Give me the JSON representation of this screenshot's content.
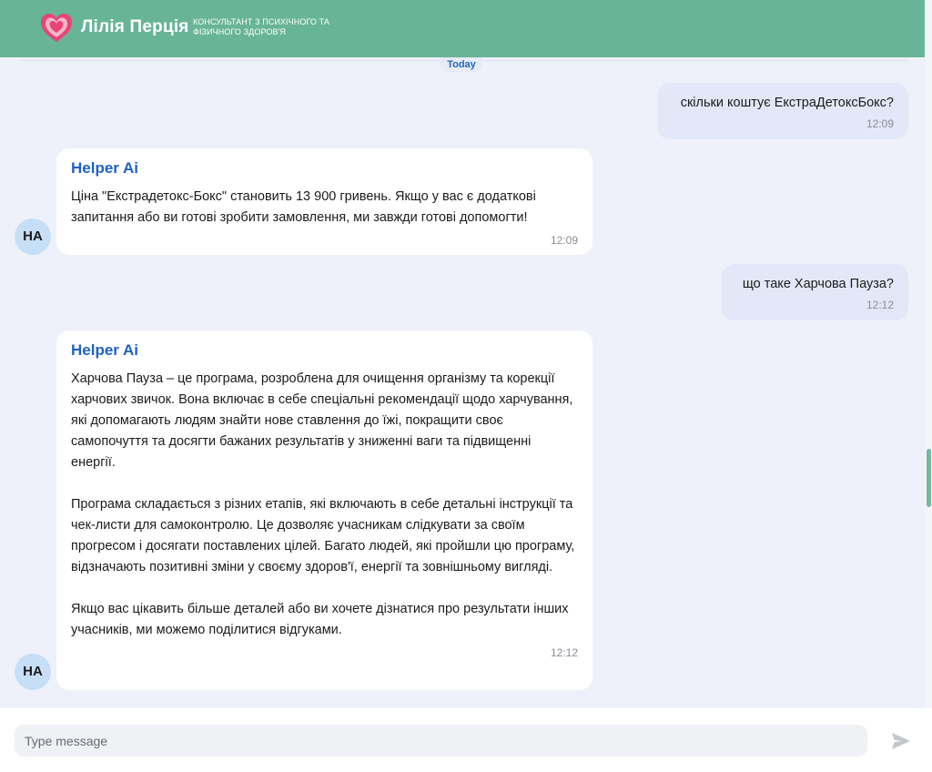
{
  "header": {
    "brand_name": "Лілія Перція",
    "tagline": "Консультант з психічного та фізичного здоров'я",
    "logo_icon": "heart-icon",
    "accent_color": "#68b498"
  },
  "chat": {
    "date_divider": "Today",
    "messages": [
      {
        "role": "user",
        "text": "скільки коштує ЕкстраДетоксБокс?",
        "time": "12:09"
      },
      {
        "role": "bot",
        "sender": "Helper Ai",
        "avatar": "HA",
        "paragraphs": [
          "Ціна \"Екстрадетокс-Бокс\" становить 13 900 гривень. Якщо у вас є додаткові запитання або ви готові зробити замовлення, ми завжди готові допомогти!"
        ],
        "time": "12:09"
      },
      {
        "role": "user",
        "text": "що таке Харчова Пауза?",
        "time": "12:12"
      },
      {
        "role": "bot",
        "sender": "Helper Ai",
        "avatar": "HA",
        "paragraphs": [
          "Харчова Пауза – це програма, розроблена для очищення організму та корекції харчових звичок. Вона включає в себе спеціальні рекомендації щодо харчування, які допомагають людям знайти нове ставлення до їжі, покращити своє самопочуття та досягти бажаних результатів у зниженні ваги та підвищенні енергії.",
          "Програма складається з різних етапів, які включають в себе детальні інструкції та чек-листи для самоконтролю. Це дозволяє учасникам слідкувати за своїм прогресом і досягати поставлених цілей. Багато людей, які пройшли цю програму, відзначають позитивні зміни у своєму здоров'ї, енергії та зовнішньому вигляді.",
          "Якщо вас цікавить більше деталей або ви хочете дізнатися про результати інших учасників, ми можемо поділитися відгуками."
        ],
        "time": "12:12"
      }
    ]
  },
  "composer": {
    "placeholder": "Type message",
    "value": "",
    "send_icon": "send-icon"
  }
}
